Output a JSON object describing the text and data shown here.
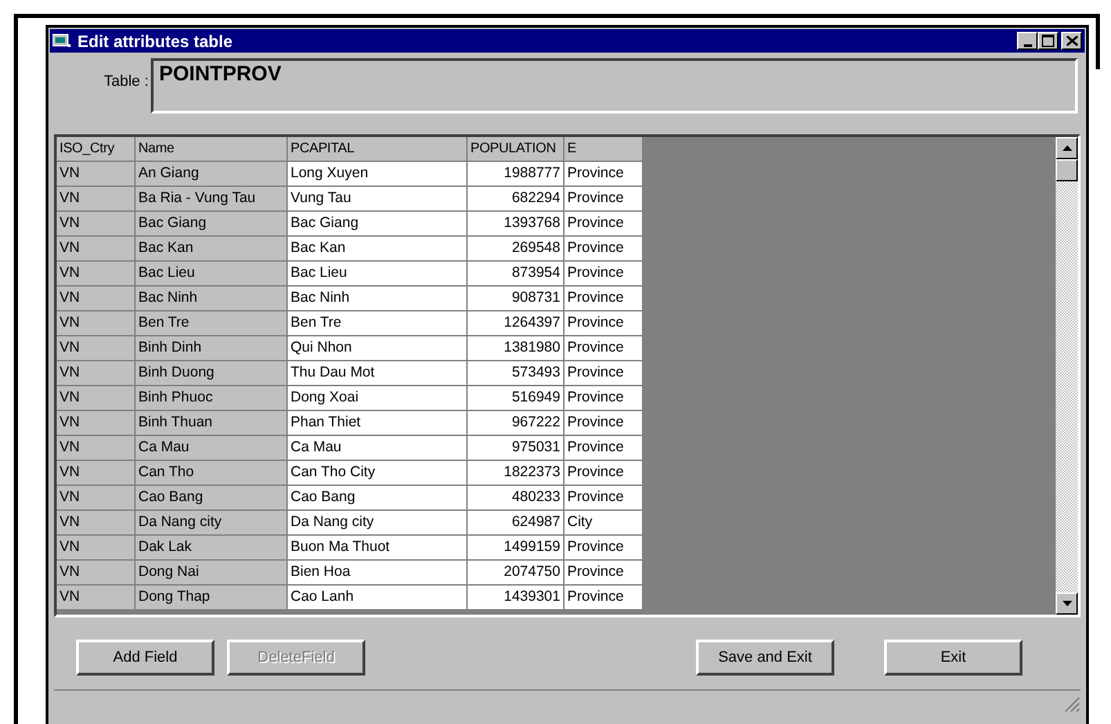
{
  "window": {
    "title": "Edit attributes table"
  },
  "table_field": {
    "label": "Table :",
    "value": "POINTPROV"
  },
  "grid": {
    "columns": [
      {
        "label": "ISO_Ctry",
        "shaded": true,
        "kind": "text"
      },
      {
        "label": "Name",
        "shaded": true,
        "kind": "text"
      },
      {
        "label": "PCAPITAL",
        "shaded": false,
        "kind": "text"
      },
      {
        "label": "POPULATION",
        "shaded": false,
        "kind": "number"
      },
      {
        "label": "E",
        "shaded": false,
        "kind": "text"
      }
    ],
    "rows": [
      [
        "VN",
        "An Giang",
        "Long Xuyen",
        "1988777",
        "Province"
      ],
      [
        "VN",
        "Ba Ria - Vung Tau",
        "Vung Tau",
        "682294",
        "Province"
      ],
      [
        "VN",
        "Bac Giang",
        "Bac Giang",
        "1393768",
        "Province"
      ],
      [
        "VN",
        "Bac Kan",
        "Bac Kan",
        "269548",
        "Province"
      ],
      [
        "VN",
        "Bac Lieu",
        "Bac Lieu",
        "873954",
        "Province"
      ],
      [
        "VN",
        "Bac Ninh",
        "Bac Ninh",
        "908731",
        "Province"
      ],
      [
        "VN",
        "Ben Tre",
        "Ben Tre",
        "1264397",
        "Province"
      ],
      [
        "VN",
        "Binh Dinh",
        "Qui Nhon",
        "1381980",
        "Province"
      ],
      [
        "VN",
        "Binh Duong",
        "Thu Dau Mot",
        "573493",
        "Province"
      ],
      [
        "VN",
        "Binh Phuoc",
        "Dong Xoai",
        "516949",
        "Province"
      ],
      [
        "VN",
        "Binh Thuan",
        "Phan Thiet",
        "967222",
        "Province"
      ],
      [
        "VN",
        "Ca Mau",
        "Ca Mau",
        "975031",
        "Province"
      ],
      [
        "VN",
        "Can Tho",
        "Can Tho City",
        "1822373",
        "Province"
      ],
      [
        "VN",
        "Cao Bang",
        "Cao Bang",
        "480233",
        "Province"
      ],
      [
        "VN",
        "Da Nang city",
        "Da Nang city",
        "624987",
        "City"
      ],
      [
        "VN",
        "Dak Lak",
        "Buon Ma Thuot",
        "1499159",
        "Province"
      ],
      [
        "VN",
        "Dong Nai",
        "Bien Hoa",
        "2074750",
        "Province"
      ],
      [
        "VN",
        "Dong Thap",
        "Cao Lanh",
        "1439301",
        "Province"
      ]
    ]
  },
  "buttons": [
    {
      "label": "Add Field",
      "disabled": false
    },
    {
      "label": "DeleteField",
      "disabled": true
    },
    {
      "label": "Save and Exit",
      "disabled": false
    },
    {
      "label": "Exit",
      "disabled": false
    }
  ]
}
